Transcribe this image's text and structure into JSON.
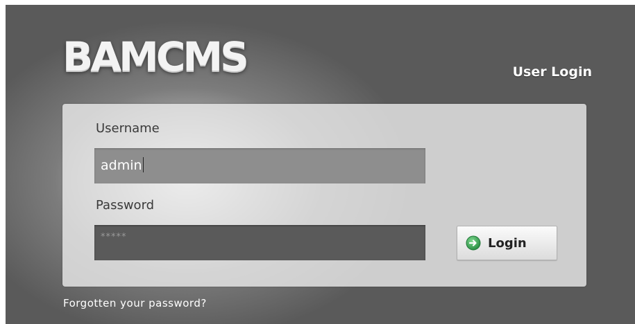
{
  "logo": {
    "text": "BAMCMS"
  },
  "panel": {
    "title": "User Login"
  },
  "form": {
    "username": {
      "label": "Username",
      "value": "admin"
    },
    "password": {
      "label": "Password",
      "masked_value": "*****"
    },
    "login_button": {
      "label": "Login",
      "icon": "arrow-right-circle-icon"
    },
    "forgot_link": "Forgotten your password?"
  },
  "colors": {
    "panel_dark": "#5a5a5a",
    "panel_light": "#ececec",
    "button_icon": "#3aa55a",
    "title_text": "#ffffff"
  }
}
